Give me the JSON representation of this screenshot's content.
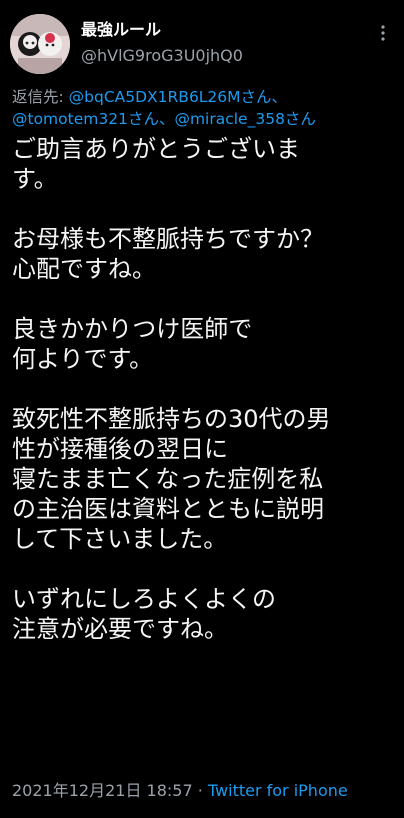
{
  "author": {
    "display_name": "最強ルール",
    "handle": "@hVlG9roG3U0jhQ0"
  },
  "reply_to": {
    "prefix": "返信先: ",
    "mentions": [
      "@bqCA5DX1RB6L26Mさん、",
      "@tomotem321さん、",
      "@miracle_358さん"
    ]
  },
  "body": {
    "paragraphs": [
      "ご助言ありがとうございま\nす。",
      "お母様も不整脈持ちですか？\n心配ですね。",
      "良きかかりつけ医師で\n何よりです。",
      "致死性不整脈持ちの30代の男\n性が接種後の翌日に\n寝たまま亡くなった症例を私\nの主治医は資料とともに説明\nして下さいました。",
      "いずれにしろよくよくの\n注意が必要ですね。"
    ]
  },
  "meta": {
    "timestamp": "2021年12月21日 18:57",
    "separator": " · ",
    "source": "Twitter for iPhone"
  },
  "icons": {
    "more": "more-icon",
    "avatar": "avatar-image"
  }
}
